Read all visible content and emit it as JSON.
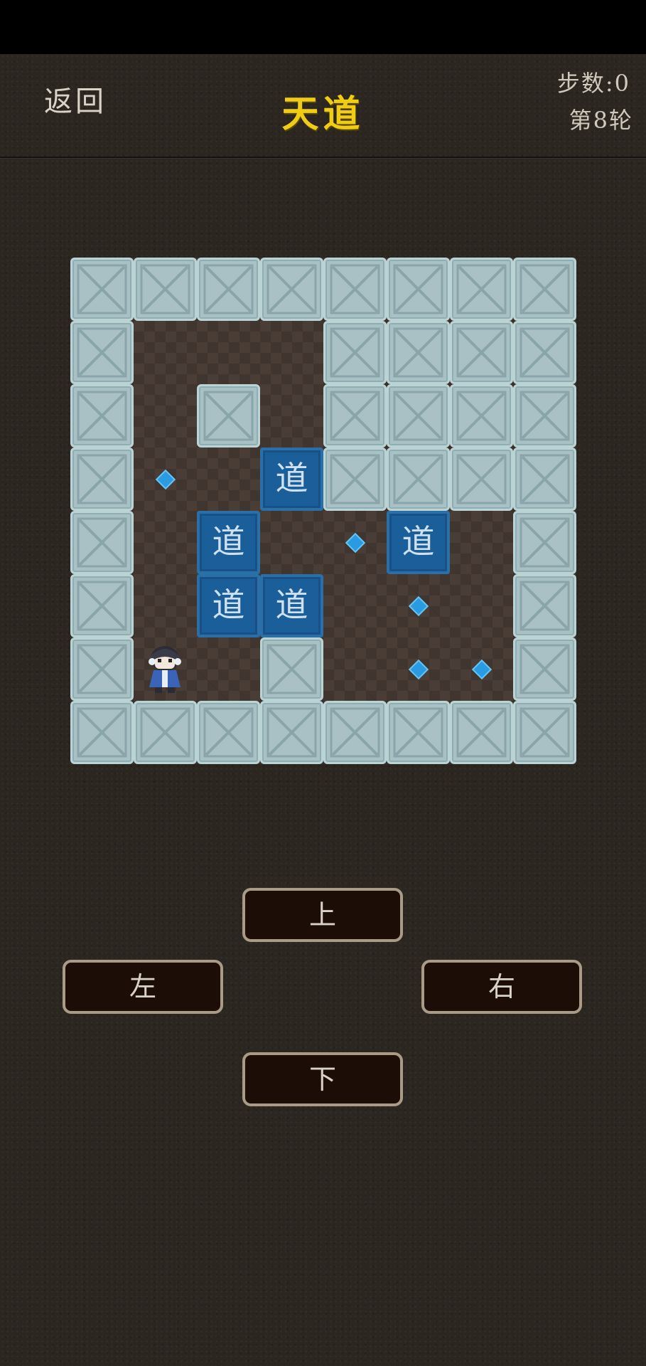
{
  "header": {
    "back_label": "返回",
    "title": "天道",
    "steps_label": "步数:",
    "steps_value": "0",
    "round_label": "第8轮"
  },
  "board": {
    "rows": 8,
    "cols": 8,
    "legend": {
      "#": "wall",
      ".": "floor",
      "B": "box",
      "G": "goal",
      "P": "player"
    },
    "grid": [
      "########",
      "#...####",
      "#.#.####",
      "#G.B####",
      "#.B.GB.#",
      "#.BB.G.#",
      "#P.#.GG#",
      "########"
    ],
    "box_text": "道",
    "colors": {
      "wall": "#a9c1c4",
      "box": "#1b5f9a",
      "goal": "#2a9be0",
      "title": "#f0cc12"
    }
  },
  "controls": {
    "up": "上",
    "left": "左",
    "right": "右",
    "down": "下"
  }
}
